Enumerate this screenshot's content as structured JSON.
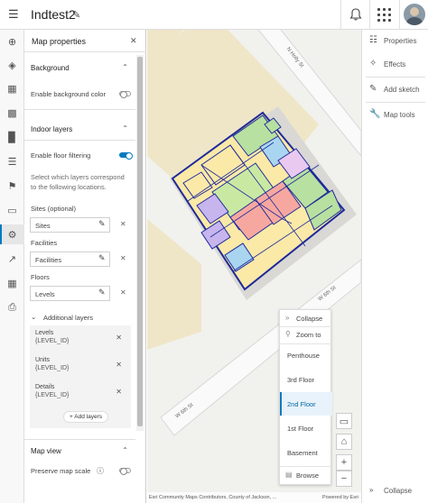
{
  "header": {
    "title": "Indtest2",
    "icons": [
      "menu-icon",
      "pencil-icon",
      "bell-icon",
      "apps-icon",
      "avatar"
    ]
  },
  "left_toolbar": {
    "items": [
      "add-icon",
      "layers-icon",
      "table-icon",
      "chart-icon",
      "bar-chart-icon",
      "legend-icon",
      "bookmark-icon",
      "media-icon",
      "gear-icon",
      "share-icon",
      "widgets-icon",
      "print-icon"
    ],
    "active_index": 8
  },
  "panel": {
    "title": "Map properties",
    "background": {
      "section_label": "Background",
      "enable_bg_color": "Enable background color",
      "enable_bg_color_on": false
    },
    "indoor": {
      "section_label": "Indoor layers",
      "enable_floor_filtering": "Enable floor filtering",
      "enable_floor_filtering_on": true,
      "help": "Select which layers correspond to the following locations.",
      "sites_label": "Sites (optional)",
      "sites_value": "Sites",
      "facilities_label": "Facilities",
      "facilities_value": "Facilities",
      "floors_label": "Floors",
      "floors_value": "Levels",
      "additional_label": "Additional layers",
      "additional": [
        {
          "name": "Levels",
          "field": "{LEVEL_ID}"
        },
        {
          "name": "Units",
          "field": "{LEVEL_ID}"
        },
        {
          "name": "Details",
          "field": "{LEVEL_ID}"
        }
      ],
      "add_layers": "Add layers"
    },
    "mapview": {
      "section_label": "Map view",
      "preserve_scale": "Preserve map scale"
    }
  },
  "map": {
    "streets": {
      "holly": "N Holly St",
      "w6th_top": "W 6th St",
      "w6th_bottom": "W 6th St"
    },
    "floor_widget": {
      "collapse": "Collapse",
      "zoom_to": "Zoom to",
      "floors": [
        "Penthouse",
        "3rd Floor",
        "2nd Floor",
        "1st Floor",
        "Basement"
      ],
      "selected": "2nd Floor",
      "browse": "Browse"
    },
    "attribution": "Esri Community Maps Contributors, County of Jackson, ...",
    "powered_by": "Powered by Esri"
  },
  "right_toolbar": {
    "items": [
      {
        "label": "Properties",
        "icon": "sliders-icon"
      },
      {
        "label": "Effects",
        "icon": "sparkle-icon"
      },
      {
        "label": "Add sketch",
        "icon": "sketch-icon"
      },
      {
        "label": "Map tools",
        "icon": "wrench-icon"
      }
    ],
    "collapse": "Collapse"
  },
  "colors": {
    "accent": "#007ac2",
    "building_outline": "#1e2a9a",
    "ground": "#efe6c8"
  }
}
